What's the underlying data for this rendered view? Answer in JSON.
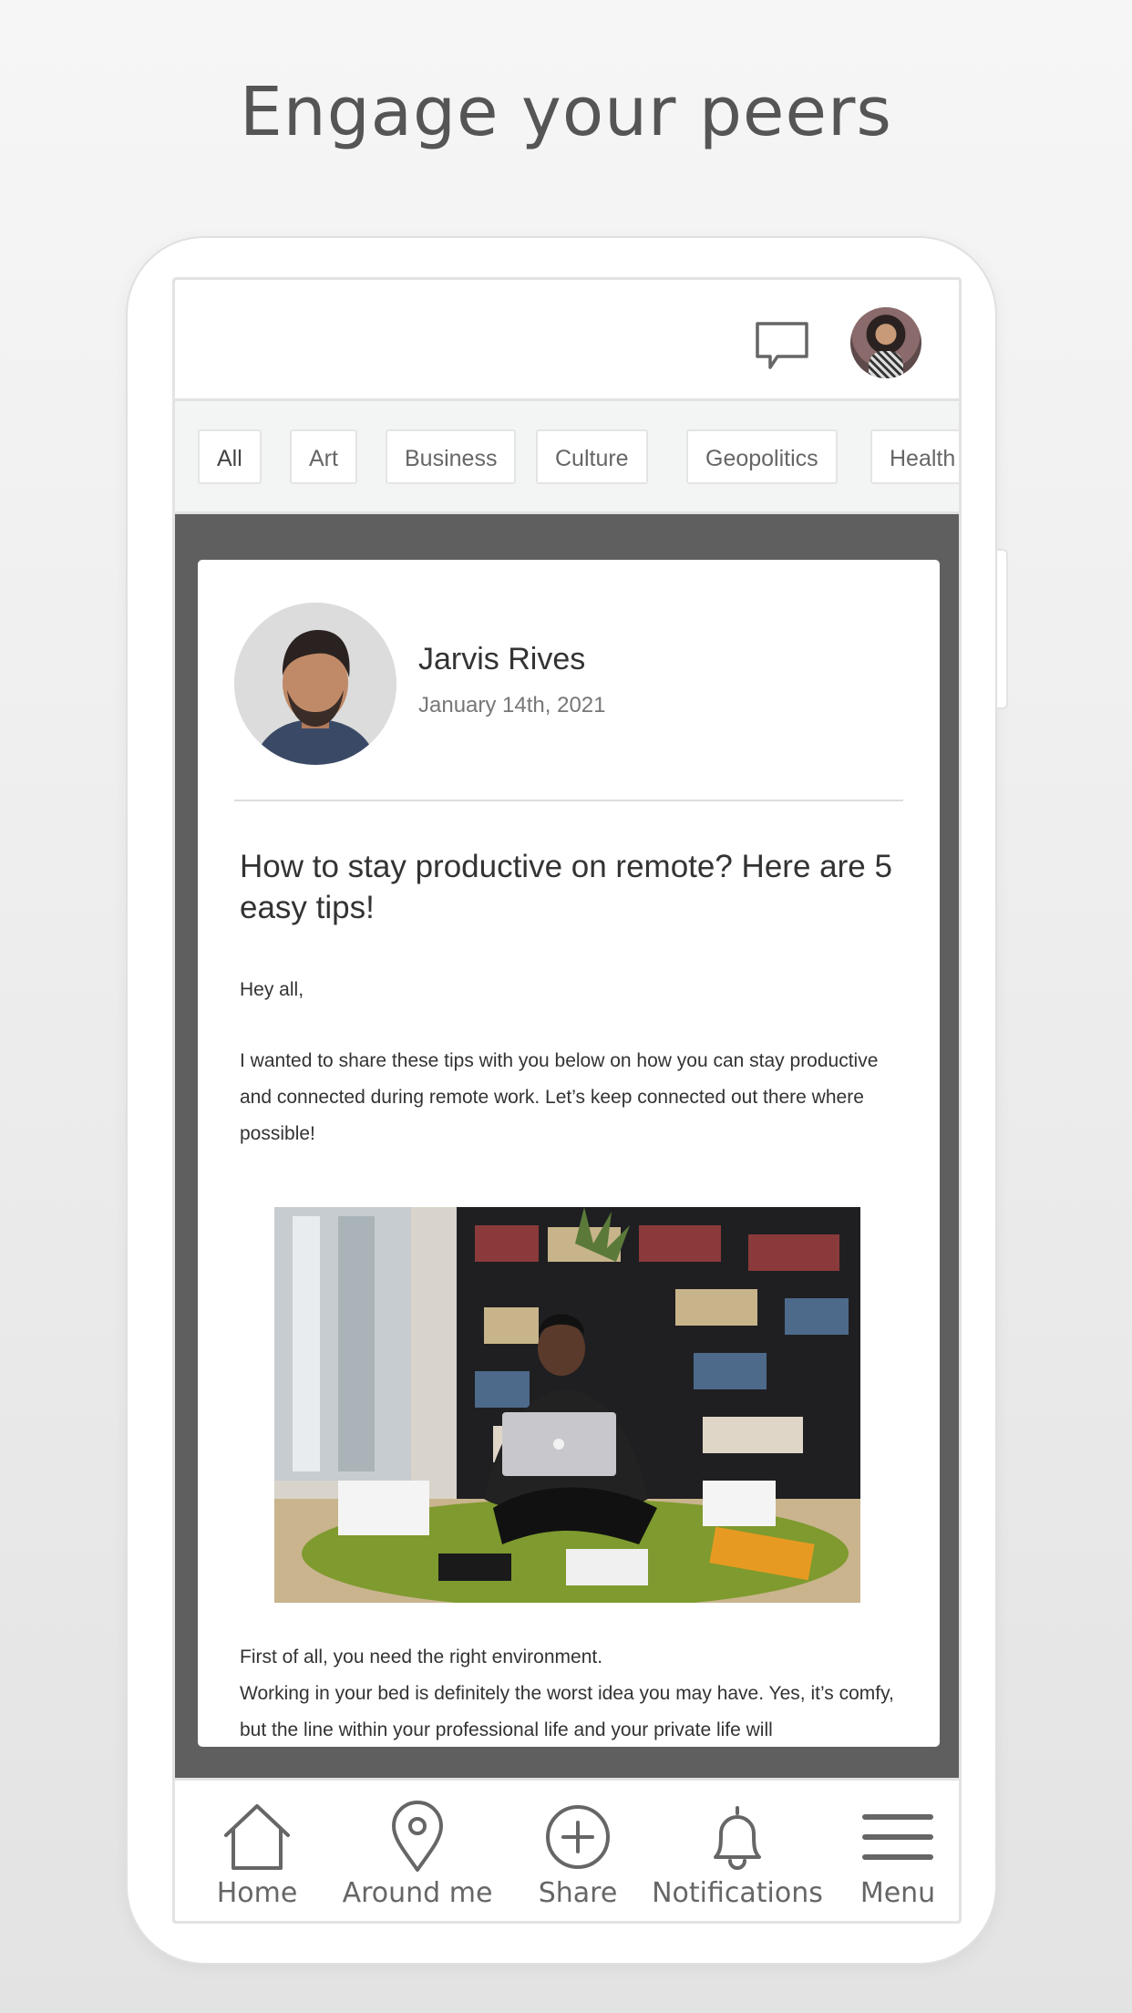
{
  "headline": "Engage your peers",
  "icons": {
    "chat": "chat-bubble-icon",
    "profile": "profile-avatar",
    "home": "home-icon",
    "around_me": "map-pin-icon",
    "share": "plus-circle-icon",
    "notifications": "bell-icon",
    "menu": "hamburger-menu-icon"
  },
  "categories": [
    "All",
    "Art",
    "Business",
    "Culture",
    "Geopolitics",
    "Health"
  ],
  "post": {
    "author": "Jarvis Rives",
    "date": "January 14th, 2021",
    "title": "How to stay productive on remote? Here are 5 easy tips!",
    "greeting": "Hey all,",
    "intro": "I wanted to share these tips with you below on how you can stay productive and connected during remote work. Let’s keep connected out there where possible!",
    "tail_line1": "First of all, you need the right environment.",
    "tail_line2": "Working in your bed is definitely the worst idea you may have. Yes, it’s comfy, but the line within your professional life and your private life will"
  },
  "nav": {
    "home": "Home",
    "around_me": "Around me",
    "share": "Share",
    "notifications": "Notifications",
    "menu": "Menu"
  },
  "colors": {
    "feed_background": "#5f5f5f",
    "icon_gray": "#666666",
    "text_dark": "#333333"
  }
}
